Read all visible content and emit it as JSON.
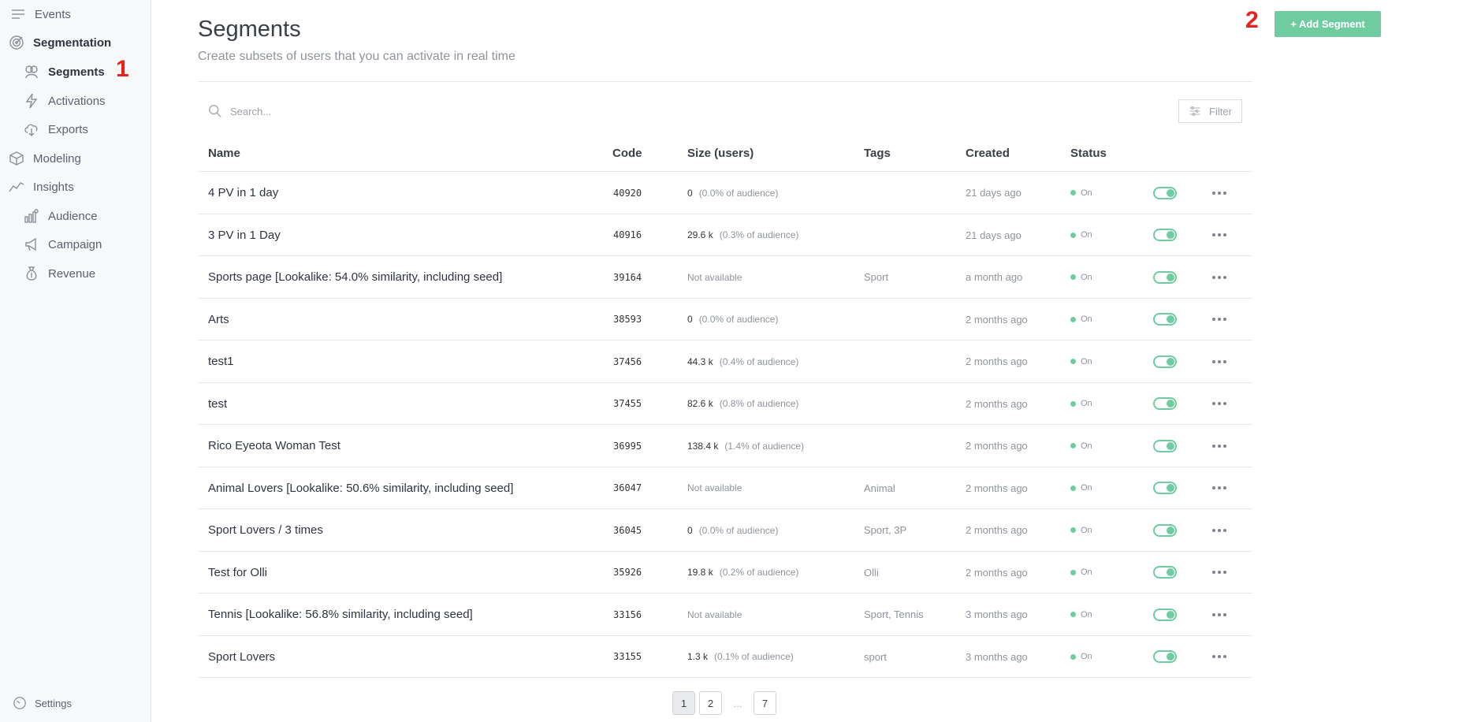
{
  "sidebar": {
    "events": "Events",
    "segmentation": "Segmentation",
    "segments": "Segments",
    "activations": "Activations",
    "exports": "Exports",
    "modeling": "Modeling",
    "insights": "Insights",
    "audience": "Audience",
    "campaign": "Campaign",
    "revenue": "Revenue",
    "settings": "Settings"
  },
  "markers": {
    "one": "1",
    "two": "2"
  },
  "header": {
    "title": "Segments",
    "subtitle": "Create subsets of users that you can activate in real time",
    "add_button": "+ Add Segment"
  },
  "search": {
    "placeholder": "Search..."
  },
  "filter": {
    "label": "Filter"
  },
  "columns": {
    "name": "Name",
    "code": "Code",
    "size": "Size (users)",
    "tags": "Tags",
    "created": "Created",
    "status": "Status"
  },
  "rows": [
    {
      "name": "4 PV in 1 day",
      "code": "40920",
      "size": "0",
      "pct": "(0.0% of audience)",
      "tags": "",
      "created": "21 days ago",
      "status": "On"
    },
    {
      "name": "3 PV in 1 Day",
      "code": "40916",
      "size": "29.6 k",
      "pct": "(0.3% of audience)",
      "tags": "",
      "created": "21 days ago",
      "status": "On"
    },
    {
      "name": "Sports page [Lookalike: 54.0% similarity, including seed]",
      "code": "39164",
      "size": "Not available",
      "pct": "",
      "tags": "Sport",
      "created": "a month ago",
      "status": "On"
    },
    {
      "name": "Arts",
      "code": "38593",
      "size": "0",
      "pct": "(0.0% of audience)",
      "tags": "",
      "created": "2 months ago",
      "status": "On"
    },
    {
      "name": "test1",
      "code": "37456",
      "size": "44.3 k",
      "pct": "(0.4% of audience)",
      "tags": "",
      "created": "2 months ago",
      "status": "On"
    },
    {
      "name": "test",
      "code": "37455",
      "size": "82.6 k",
      "pct": "(0.8% of audience)",
      "tags": "",
      "created": "2 months ago",
      "status": "On"
    },
    {
      "name": "Rico Eyeota Woman Test",
      "code": "36995",
      "size": "138.4 k",
      "pct": "(1.4% of audience)",
      "tags": "",
      "created": "2 months ago",
      "status": "On"
    },
    {
      "name": "Animal Lovers [Lookalike: 50.6% similarity, including seed]",
      "code": "36047",
      "size": "Not available",
      "pct": "",
      "tags": "Animal",
      "created": "2 months ago",
      "status": "On"
    },
    {
      "name": "Sport Lovers / 3 times",
      "code": "36045",
      "size": "0",
      "pct": "(0.0% of audience)",
      "tags": "Sport, 3P",
      "created": "2 months ago",
      "status": "On"
    },
    {
      "name": "Test for Olli",
      "code": "35926",
      "size": "19.8 k",
      "pct": "(0.2% of audience)",
      "tags": "Olli",
      "created": "2 months ago",
      "status": "On"
    },
    {
      "name": "Tennis [Lookalike: 56.8% similarity, including seed]",
      "code": "33156",
      "size": "Not available",
      "pct": "",
      "tags": "Sport, Tennis",
      "created": "3 months ago",
      "status": "On"
    },
    {
      "name": "Sport Lovers",
      "code": "33155",
      "size": "1.3 k",
      "pct": "(0.1% of audience)",
      "tags": "sport",
      "created": "3 months ago",
      "status": "On"
    }
  ],
  "pagination": {
    "p1": "1",
    "p2": "2",
    "ellipsis": "...",
    "p7": "7"
  },
  "colors": {
    "accent": "#6fcba0",
    "marker": "#e8221c"
  }
}
